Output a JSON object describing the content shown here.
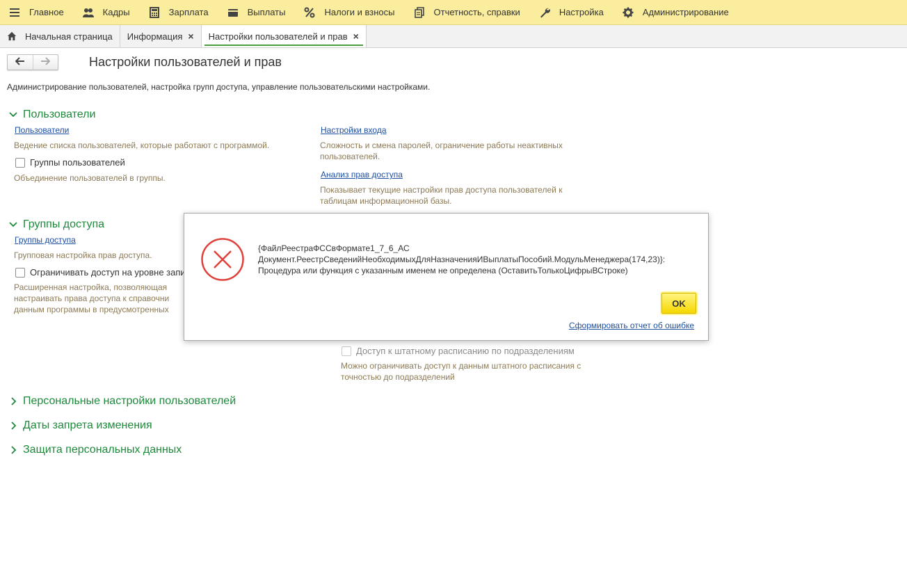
{
  "topmenu": [
    {
      "label": "Главное",
      "icon": "menu-icon"
    },
    {
      "label": "Кадры",
      "icon": "people-icon"
    },
    {
      "label": "Зарплата",
      "icon": "calculator-icon"
    },
    {
      "label": "Выплаты",
      "icon": "wallet-icon"
    },
    {
      "label": "Налоги и взносы",
      "icon": "percent-icon"
    },
    {
      "label": "Отчетность, справки",
      "icon": "documents-icon"
    },
    {
      "label": "Настройка",
      "icon": "wrench-icon"
    },
    {
      "label": "Администрирование",
      "icon": "gear-icon"
    }
  ],
  "tabs": {
    "home": "Начальная страница",
    "info": "Информация",
    "settings": "Настройки пользователей и прав",
    "close_glyph": "×"
  },
  "page": {
    "title": "Настройки пользователей и прав",
    "description": "Администрирование пользователей, настройка групп доступа, управление пользовательскими настройками."
  },
  "users_group": {
    "title": "Пользователи",
    "users_link": "Пользователи",
    "users_note": "Ведение списка пользователей, которые работают с программой.",
    "user_groups_check": "Группы пользователей",
    "user_groups_note": "Объединение пользователей в группы.",
    "login_settings_link": "Настройки входа",
    "login_settings_note_1": "Сложность и смена паролей, ограничение работы неактивных",
    "login_settings_note_2": "пользователей.",
    "rights_analysis_link": "Анализ прав доступа",
    "rights_analysis_note_1": "Показывает текущие настройки прав доступа пользователей к",
    "rights_analysis_note_2": "таблицам информационной базы."
  },
  "access_group": {
    "title": "Группы доступа",
    "access_groups_link": "Группы доступа",
    "access_groups_note": "Групповая настройка прав доступа.",
    "restrict_check": "Ограничивать доступ на уровне запи",
    "restrict_note_1": "Расширенная настройка, позволяющая",
    "restrict_note_2": "настраивать права доступа к справочни",
    "restrict_note_3": "данным программы в предусмотренных",
    "staff_check": "Доступ к штатному расписанию по подразделениям",
    "staff_note_1": "Можно ограничивать доступ к данным штатного расписания с",
    "staff_note_2": "точностью до подразделений"
  },
  "collapsed_groups": {
    "personal": "Персональные настройки пользователей",
    "dates": "Даты запрета изменения",
    "protection": "Защита персональных данных"
  },
  "dialog": {
    "line1": "{ФайлРеестраФССвФормате1_7_6_АС",
    "line2": "Документ.РеестрСведенийНеобходимыхДляНазначенияИВыплатыПособий.МодульМенеджера(174,23)}:",
    "line3": "Процедура или функция с указанным именем не определена (ОставитьТолькоЦифрыВСтроке)",
    "ok_label": "OK",
    "report_link": "Сформировать отчет об ошибке"
  },
  "colors": {
    "menu_bg": "#fbed9e",
    "group_title": "#1d8a3b",
    "link": "#1e4fa0",
    "note": "#8c7a55",
    "error_red": "#e0403a",
    "ok_button": "#f5d800"
  }
}
